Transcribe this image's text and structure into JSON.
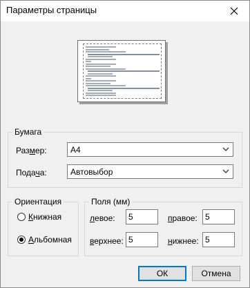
{
  "window": {
    "title": "Параметры страницы",
    "close_icon": "close-icon"
  },
  "paper": {
    "legend": "Бумага",
    "size": {
      "label_prefix": "Раз",
      "label_key": "м",
      "label_suffix": "ер:",
      "value": "A4"
    },
    "source": {
      "label_prefix": "Пода",
      "label_key": "ч",
      "label_suffix": "а:",
      "value": "Автовыбор"
    }
  },
  "orientation": {
    "legend": "Ориентация",
    "portrait": {
      "key": "К",
      "rest": "нижная",
      "selected": false
    },
    "landscape": {
      "key": "А",
      "rest": "льбомная",
      "selected": true
    }
  },
  "margins": {
    "legend": "Поля (мм)",
    "left": {
      "key": "л",
      "rest": "евое:",
      "value": "5"
    },
    "right": {
      "key": "п",
      "rest": "равое:",
      "value": "5"
    },
    "top": {
      "key": "в",
      "rest": "ерхнее:",
      "value": "5"
    },
    "bottom": {
      "key": "н",
      "rest": "ижнее:",
      "value": "5"
    }
  },
  "buttons": {
    "ok": "ОК",
    "cancel": "Отмена"
  }
}
